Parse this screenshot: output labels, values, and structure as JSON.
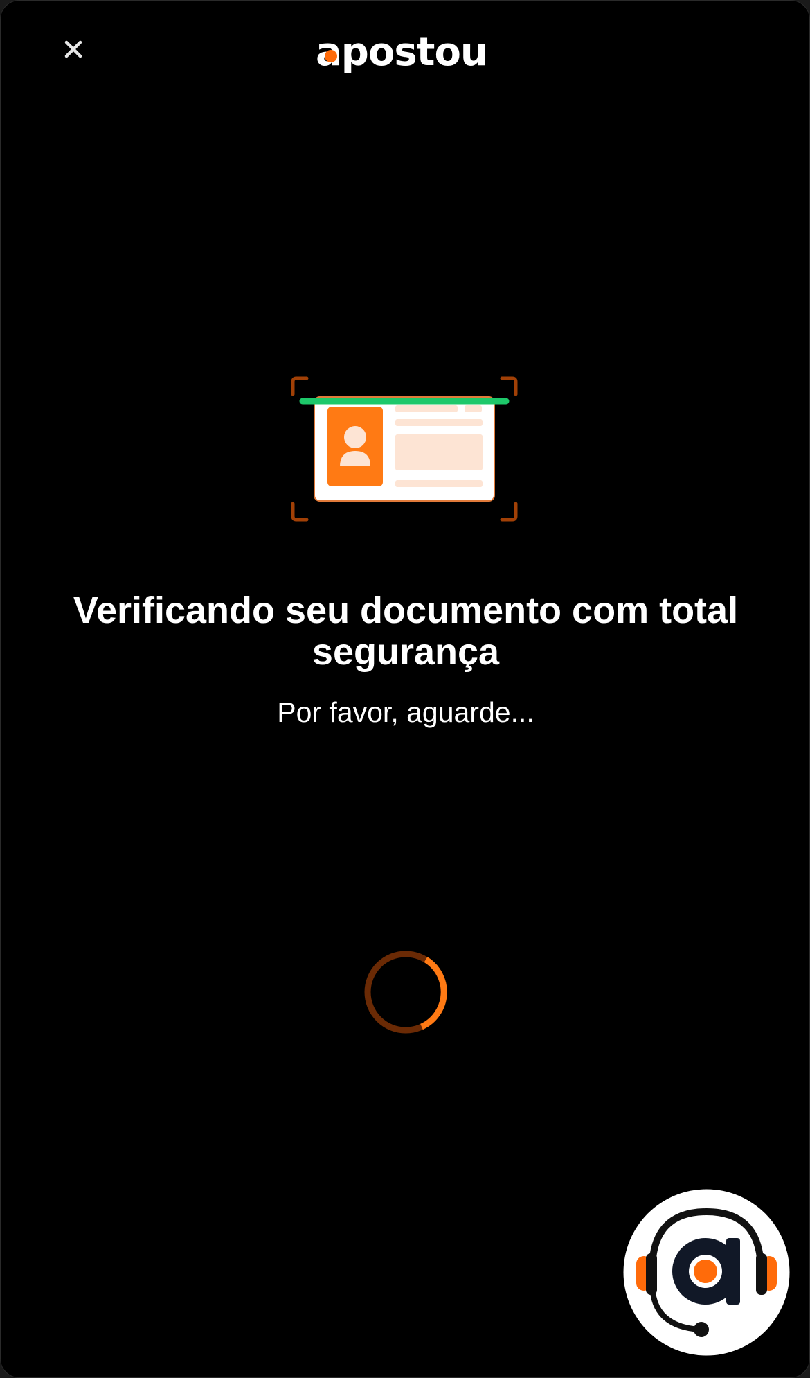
{
  "header": {
    "close_icon": "close-icon",
    "logo_text": "apostou"
  },
  "main": {
    "illustration_icon": "id-card-scan-icon",
    "title": "Verificando seu documento com total segurança",
    "subtitle": "Por favor, aguarde..."
  },
  "loader": {
    "icon": "loading-spinner-icon"
  },
  "support": {
    "icon": "headset-support-icon"
  },
  "colors": {
    "background": "#000000",
    "accent": "#ff6b0a",
    "scan_line": "#1ec86a",
    "text": "#ffffff",
    "card_fill": "#fde4d4"
  }
}
